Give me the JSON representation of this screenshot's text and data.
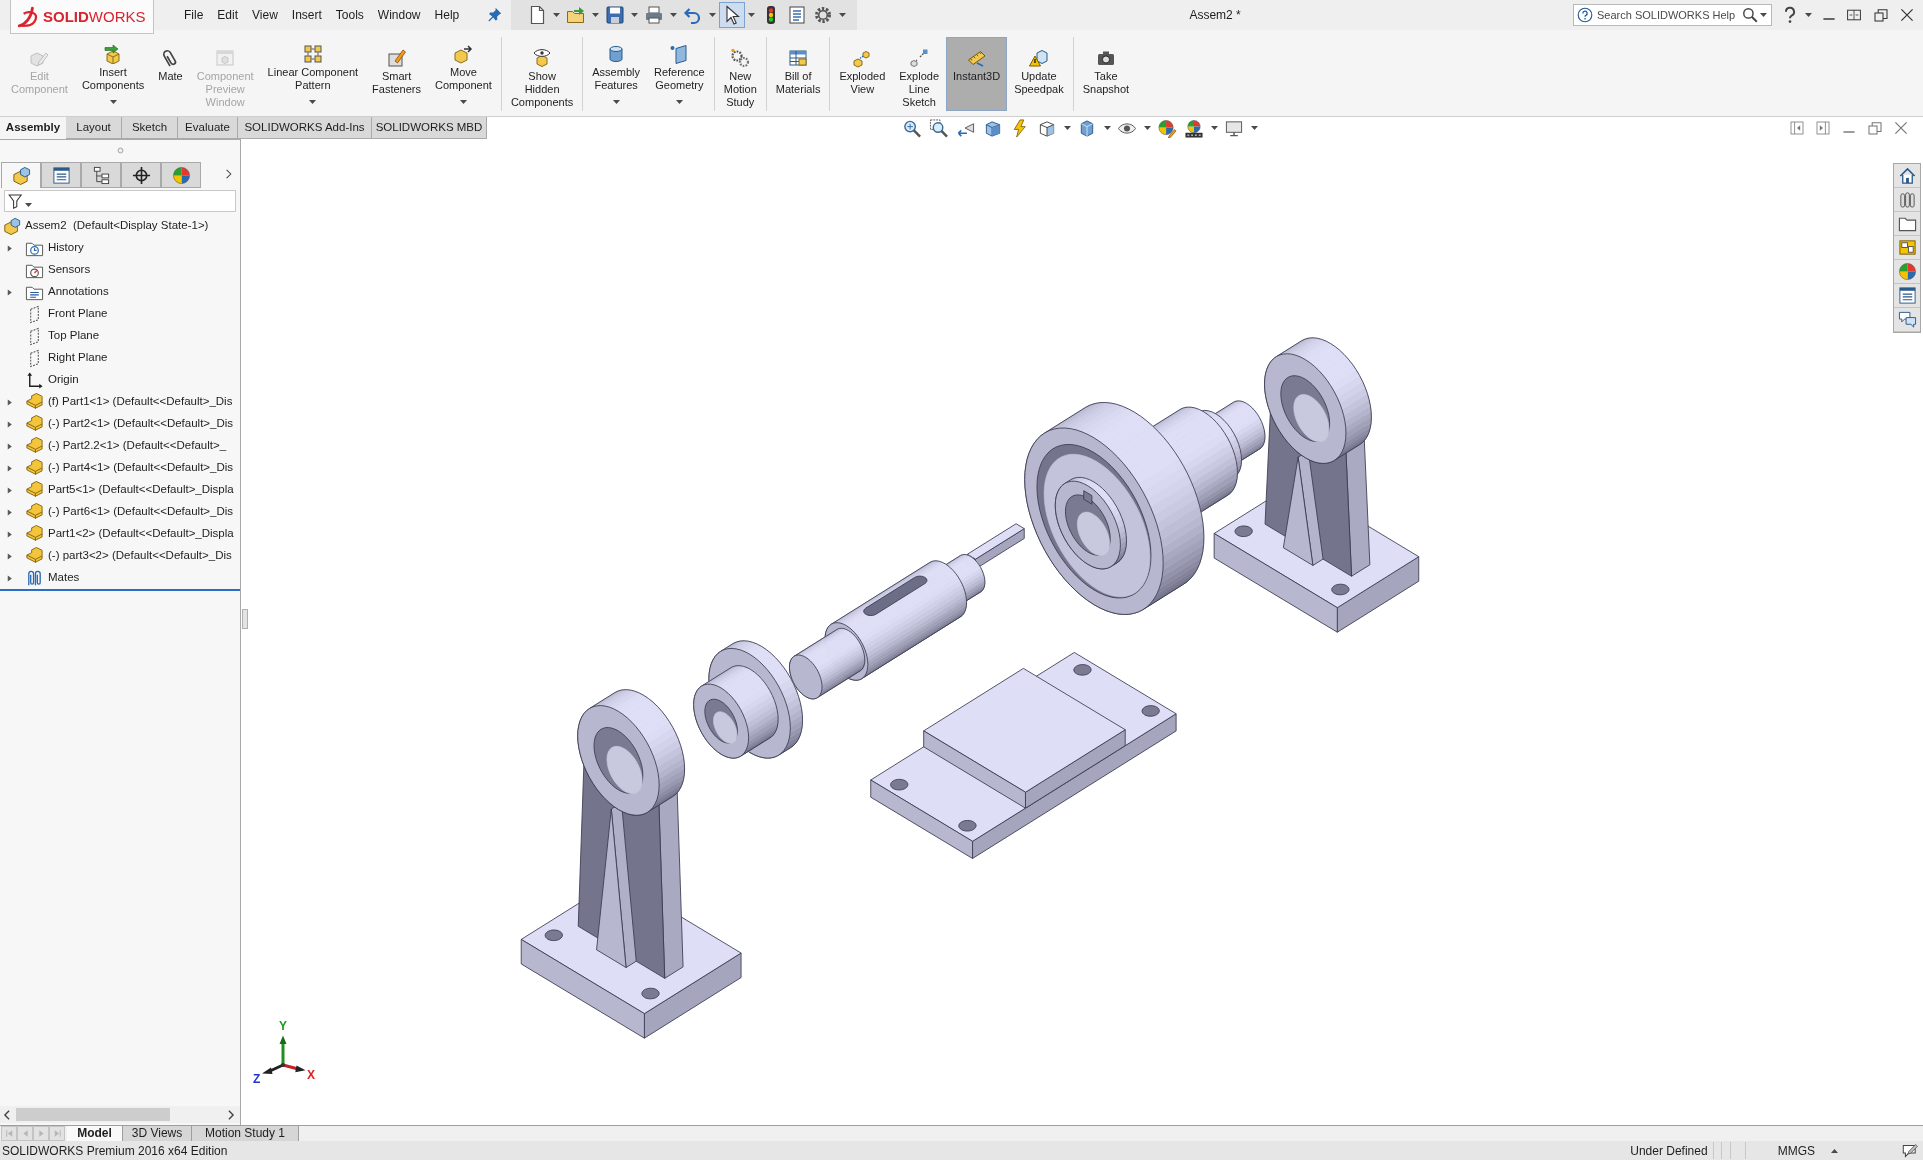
{
  "logo": {
    "text": "**SOLID**WORKS"
  },
  "menu_bar": {
    "items": [
      "File",
      "Edit",
      "View",
      "Insert",
      "Tools",
      "Window",
      "Help"
    ]
  },
  "quick_access_toolbar": [
    {
      "selected": false,
      "dropdown": true
    },
    {
      "selected": false,
      "dropdown": true
    },
    {
      "selected": false,
      "dropdown": true
    },
    {
      "selected": false,
      "dropdown": true
    },
    {
      "selected": false,
      "dropdown": true
    },
    {
      "selected": true,
      "dropdown": true
    },
    {
      "selected": false,
      "dropdown": false
    },
    {
      "selected": false,
      "dropdown": false
    },
    {
      "selected": false,
      "dropdown": true
    }
  ],
  "window": {
    "title": "Assem2 *"
  },
  "help_search": {
    "placeholder": "Search SOLIDWORKS Help"
  },
  "ribbon": {
    "groups": [
      {
        "buttons": [
          {
            "label": "Edit\nComponent",
            "disabled": true,
            "dropdown": false,
            "selected": false
          },
          {
            "label": "Insert\nComponents",
            "disabled": false,
            "dropdown": true,
            "selected": false
          },
          {
            "label": "Mate",
            "disabled": false,
            "dropdown": false,
            "selected": false
          },
          {
            "label": "Component\nPreview\nWindow",
            "disabled": true,
            "dropdown": false,
            "selected": false
          },
          {
            "label": "Linear Component\nPattern",
            "disabled": false,
            "dropdown": true,
            "selected": false
          },
          {
            "label": "Smart\nFasteners",
            "disabled": false,
            "dropdown": false,
            "selected": false
          },
          {
            "label": "Move\nComponent",
            "disabled": false,
            "dropdown": true,
            "selected": false
          }
        ]
      },
      {
        "buttons": [
          {
            "label": "Show\nHidden\nComponents",
            "disabled": false,
            "dropdown": false,
            "selected": false
          }
        ]
      },
      {
        "buttons": [
          {
            "label": "Assembly\nFeatures",
            "disabled": false,
            "dropdown": true,
            "selected": false
          },
          {
            "label": "Reference\nGeometry",
            "disabled": false,
            "dropdown": true,
            "selected": false
          }
        ]
      },
      {
        "buttons": [
          {
            "label": "New\nMotion\nStudy",
            "disabled": false,
            "dropdown": false,
            "selected": false
          }
        ]
      },
      {
        "buttons": [
          {
            "label": "Bill of\nMaterials",
            "disabled": false,
            "dropdown": false,
            "selected": false
          }
        ]
      },
      {
        "buttons": [
          {
            "label": "Exploded\nView",
            "disabled": false,
            "dropdown": false,
            "selected": false
          },
          {
            "label": "Explode\nLine\nSketch",
            "disabled": false,
            "dropdown": false,
            "selected": false
          },
          {
            "label": "Instant3D",
            "disabled": false,
            "dropdown": false,
            "selected": true
          },
          {
            "label": "Update\nSpeedpak",
            "disabled": false,
            "dropdown": false,
            "selected": false
          }
        ]
      },
      {
        "buttons": [
          {
            "label": "Take\nSnapshot",
            "disabled": false,
            "dropdown": false,
            "selected": false
          }
        ]
      }
    ]
  },
  "ribbon_tabs": [
    {
      "label": "Assembly",
      "selected": true
    },
    {
      "label": "Layout",
      "selected": false
    },
    {
      "label": "Sketch",
      "selected": false
    },
    {
      "label": "Evaluate",
      "selected": false
    },
    {
      "label": "SOLIDWORKS Add-Ins",
      "selected": false
    },
    {
      "label": "SOLIDWORKS MBD",
      "selected": false
    }
  ],
  "heads_up_toolbar": [
    {
      "dropdown": false
    },
    {
      "dropdown": false
    },
    {
      "dropdown": false
    },
    {
      "dropdown": false
    },
    {
      "dropdown": false
    },
    {
      "dropdown": true
    },
    {
      "dropdown": true
    },
    {
      "dropdown": true
    },
    {
      "dropdown": false
    },
    {
      "dropdown": true
    },
    {
      "dropdown": true
    }
  ],
  "feature_manager": {
    "tabs": [
      {
        "selected": true
      },
      {
        "selected": false
      },
      {
        "selected": false
      },
      {
        "selected": false
      },
      {
        "selected": false
      }
    ],
    "tree": {
      "label": "Assem2  (Default<Display State-1>)",
      "children": [
        {
          "label": "History",
          "kind": "history",
          "expander": true
        },
        {
          "label": "Sensors",
          "kind": "sensors",
          "expander": false
        },
        {
          "label": "Annotations",
          "kind": "annotations",
          "expander": true
        },
        {
          "label": "Front Plane",
          "kind": "plane",
          "expander": false
        },
        {
          "label": "Top Plane",
          "kind": "plane",
          "expander": false
        },
        {
          "label": "Right Plane",
          "kind": "plane",
          "expander": false
        },
        {
          "label": "Origin",
          "kind": "origin",
          "expander": false
        },
        {
          "label": "(f) Part1<1> (Default<<Default>_Dis",
          "kind": "part",
          "expander": true
        },
        {
          "label": "(-) Part2<1> (Default<<Default>_Dis",
          "kind": "part",
          "expander": true
        },
        {
          "label": "(-) Part2.2<1> (Default<<Default>_",
          "kind": "part",
          "expander": true
        },
        {
          "label": "(-) Part4<1> (Default<<Default>_Dis",
          "kind": "part",
          "expander": true
        },
        {
          "label": "Part5<1> (Default<<Default>_Displa",
          "kind": "part",
          "expander": true
        },
        {
          "label": "(-) Part6<1> (Default<<Default>_Dis",
          "kind": "part",
          "expander": true
        },
        {
          "label": "Part1<2> (Default<<Default>_Displa",
          "kind": "part",
          "expander": true
        },
        {
          "label": "(-) part3<2> (Default<<Default>_Dis",
          "kind": "part",
          "expander": true
        },
        {
          "label": "Mates",
          "kind": "mates",
          "expander": true
        }
      ]
    }
  },
  "viewport": {
    "triad_labels": [
      {
        "text": "Y",
        "color": "#1c9e1c"
      },
      {
        "text": "X",
        "color": "#e0201c"
      },
      {
        "text": "Z",
        "color": "#2233d0"
      }
    ]
  },
  "document_tabs": {
    "nav_buttons": [
      {
        "disabled": true
      },
      {
        "disabled": true
      },
      {
        "disabled": true
      },
      {
        "disabled": true
      }
    ],
    "tabs": [
      {
        "label": "Model",
        "selected": true
      },
      {
        "label": "3D Views",
        "selected": false
      },
      {
        "label": "Motion Study 1",
        "selected": false
      }
    ]
  },
  "status_bar": {
    "edition": "SOLIDWORKS Premium 2016 x64 Edition",
    "state": "Under Defined",
    "units": "MMGS"
  }
}
